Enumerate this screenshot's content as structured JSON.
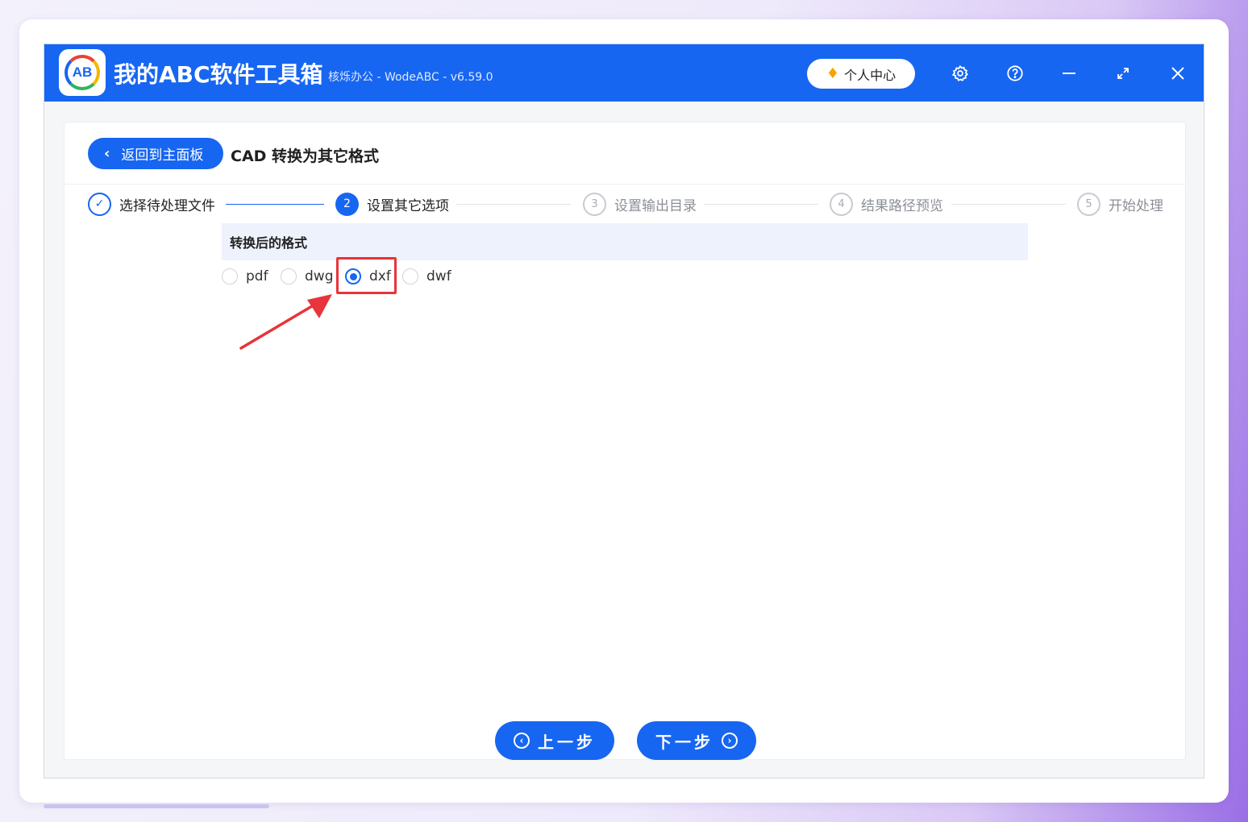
{
  "app": {
    "title": "我的ABC软件工具箱",
    "subtitle": "核烁办公 - WodeABC - v6.59.0",
    "logo_text": "AB",
    "personal_center": "个人中心",
    "brand_color": "#1766f2"
  },
  "titlebar_icons": [
    "gear-icon",
    "help-icon",
    "minimize-icon",
    "maximize-icon",
    "close-icon"
  ],
  "header": {
    "back_label": "返回到主面板",
    "page_title": "CAD 转换为其它格式"
  },
  "steps": [
    {
      "num": "✓",
      "label": "选择待处理文件",
      "state": "done"
    },
    {
      "num": "2",
      "label": "设置其它选项",
      "state": "active"
    },
    {
      "num": "3",
      "label": "设置输出目录",
      "state": "todo"
    },
    {
      "num": "4",
      "label": "结果路径预览",
      "state": "todo"
    },
    {
      "num": "5",
      "label": "开始处理",
      "state": "todo"
    }
  ],
  "options": {
    "section_title": "转换后的格式",
    "formats": [
      {
        "label": "pdf",
        "selected": false
      },
      {
        "label": "dwg",
        "selected": false
      },
      {
        "label": "dxf",
        "selected": true
      },
      {
        "label": "dwf",
        "selected": false
      }
    ]
  },
  "footer": {
    "prev_label": "上一步",
    "next_label": "下一步"
  },
  "colors": {
    "annotation": "#e8343a"
  }
}
